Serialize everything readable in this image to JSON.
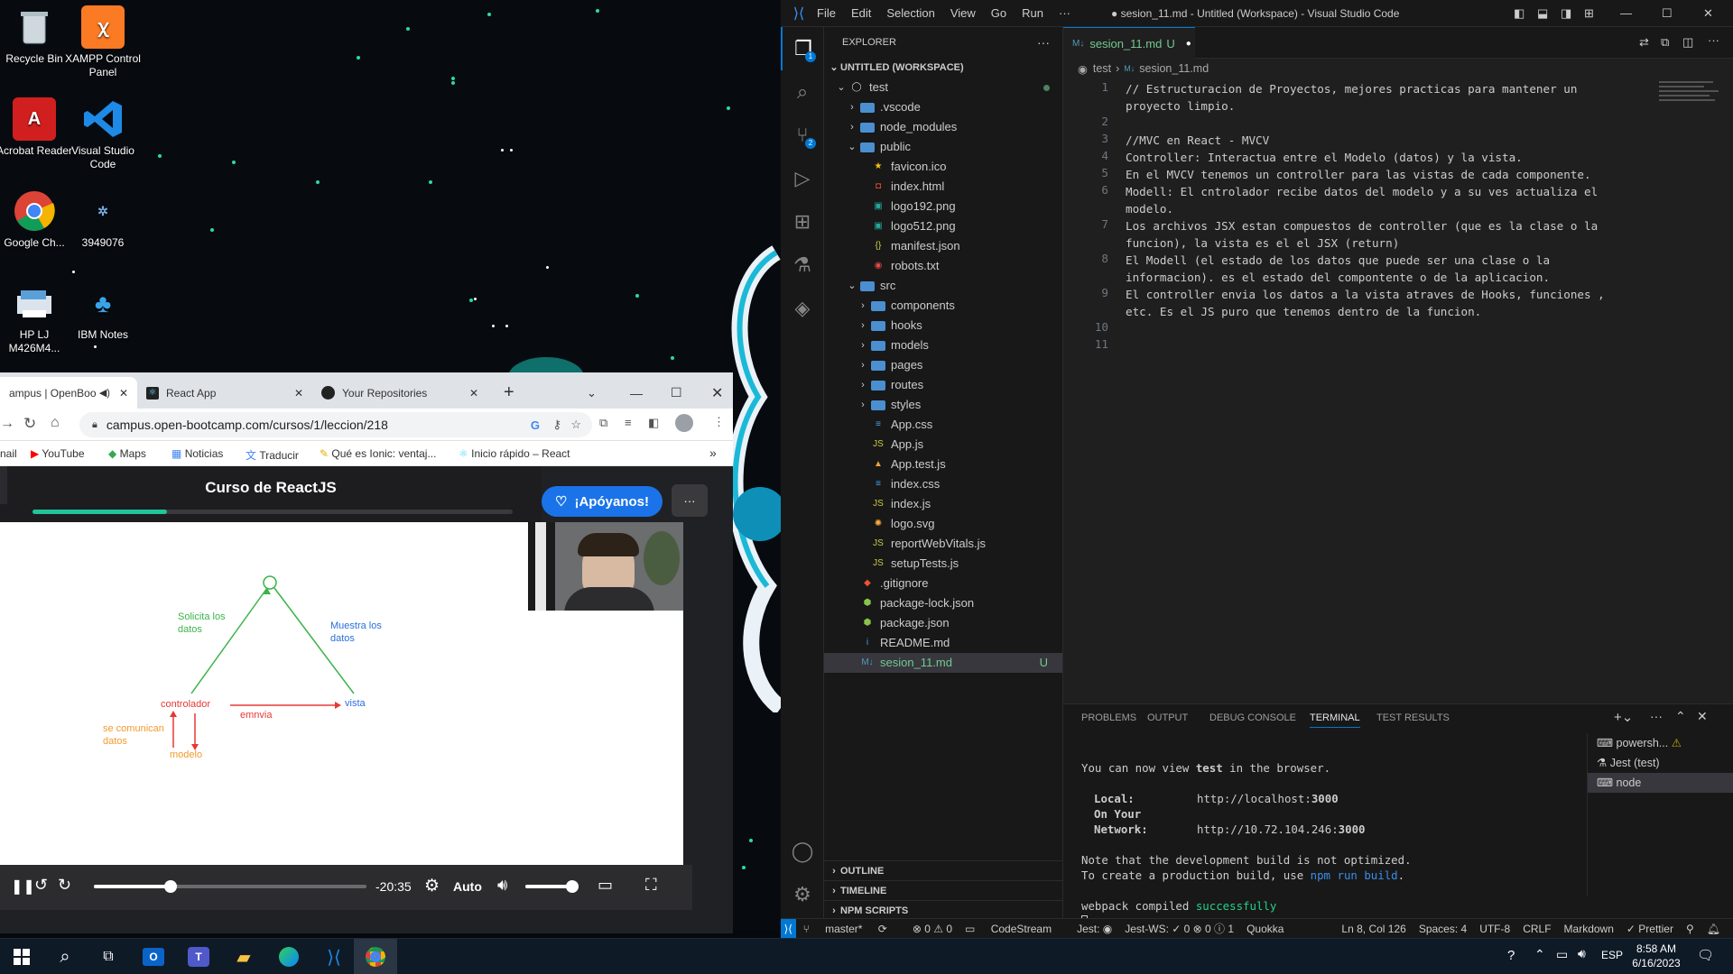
{
  "desktop": {
    "icons": [
      {
        "label": "Recycle Bin",
        "icon": "recycle-bin-icon"
      },
      {
        "label": "XAMPP Control Panel",
        "icon": "xampp-icon"
      },
      {
        "label": "Acrobat Reader",
        "icon": "acrobat-icon"
      },
      {
        "label": "Visual Studio Code",
        "icon": "vscode-icon"
      },
      {
        "label": "Google Ch...",
        "icon": "chrome-icon"
      },
      {
        "label": "3949076",
        "icon": "file-icon"
      },
      {
        "label": "HP LJ M426M4...",
        "icon": "printer-icon"
      },
      {
        "label": "IBM Notes",
        "icon": "ibm-notes-icon"
      }
    ]
  },
  "vscode": {
    "menu": [
      "File",
      "Edit",
      "Selection",
      "View",
      "Go",
      "Run",
      "···"
    ],
    "title": "● sesion_11.md - Untitled (Workspace) - Visual Studio Code",
    "explorer_title": "EXPLORER",
    "workspace": "UNTITLED (WORKSPACE)",
    "root": "test",
    "tree": [
      {
        "name": ".vscode",
        "depth": 1,
        "type": "folder",
        "open": false
      },
      {
        "name": "node_modules",
        "depth": 1,
        "type": "folder",
        "open": false
      },
      {
        "name": "public",
        "depth": 1,
        "type": "folder",
        "open": true
      },
      {
        "name": "favicon.ico",
        "depth": 2,
        "type": "file",
        "icon": "★",
        "color": "#f1c40f"
      },
      {
        "name": "index.html",
        "depth": 2,
        "type": "file",
        "icon": "◘",
        "color": "#e44d26"
      },
      {
        "name": "logo192.png",
        "depth": 2,
        "type": "file",
        "icon": "▣",
        "color": "#26a69a"
      },
      {
        "name": "logo512.png",
        "depth": 2,
        "type": "file",
        "icon": "▣",
        "color": "#26a69a"
      },
      {
        "name": "manifest.json",
        "depth": 2,
        "type": "file",
        "icon": "{}",
        "color": "#cbcb41"
      },
      {
        "name": "robots.txt",
        "depth": 2,
        "type": "file",
        "icon": "◉",
        "color": "#e24a4a"
      },
      {
        "name": "src",
        "depth": 1,
        "type": "folder",
        "open": true
      },
      {
        "name": "components",
        "depth": 2,
        "type": "folder",
        "open": false
      },
      {
        "name": "hooks",
        "depth": 2,
        "type": "folder",
        "open": false
      },
      {
        "name": "models",
        "depth": 2,
        "type": "folder",
        "open": false
      },
      {
        "name": "pages",
        "depth": 2,
        "type": "folder",
        "open": false
      },
      {
        "name": "routes",
        "depth": 2,
        "type": "folder",
        "open": false
      },
      {
        "name": "styles",
        "depth": 2,
        "type": "folder",
        "open": false
      },
      {
        "name": "App.css",
        "depth": 2,
        "type": "file",
        "icon": "≡",
        "color": "#42a5f5"
      },
      {
        "name": "App.js",
        "depth": 2,
        "type": "file",
        "icon": "JS",
        "color": "#cbcb41"
      },
      {
        "name": "App.test.js",
        "depth": 2,
        "type": "file",
        "icon": "▲",
        "color": "#e8a13a"
      },
      {
        "name": "index.css",
        "depth": 2,
        "type": "file",
        "icon": "≡",
        "color": "#42a5f5"
      },
      {
        "name": "index.js",
        "depth": 2,
        "type": "file",
        "icon": "JS",
        "color": "#cbcb41"
      },
      {
        "name": "logo.svg",
        "depth": 2,
        "type": "file",
        "icon": "✺",
        "color": "#ffb13b"
      },
      {
        "name": "reportWebVitals.js",
        "depth": 2,
        "type": "file",
        "icon": "JS",
        "color": "#cbcb41"
      },
      {
        "name": "setupTests.js",
        "depth": 2,
        "type": "file",
        "icon": "JS",
        "color": "#cbcb41"
      },
      {
        "name": ".gitignore",
        "depth": 1,
        "type": "file",
        "icon": "◆",
        "color": "#f05133"
      },
      {
        "name": "package-lock.json",
        "depth": 1,
        "type": "file",
        "icon": "⬢",
        "color": "#8bc34a"
      },
      {
        "name": "package.json",
        "depth": 1,
        "type": "file",
        "icon": "⬢",
        "color": "#8bc34a"
      },
      {
        "name": "README.md",
        "depth": 1,
        "type": "file",
        "icon": "i",
        "color": "#42a5f5"
      },
      {
        "name": "sesion_11.md",
        "depth": 1,
        "type": "file",
        "icon": "M↓",
        "color": "#519aba",
        "selected": true,
        "badge": "U"
      }
    ],
    "outline": "OUTLINE",
    "timeline": "TIMELINE",
    "npm_scripts": "NPM SCRIPTS",
    "tab": {
      "label": "sesion_11.md",
      "badge": "U"
    },
    "breadcrumb": [
      "test",
      "sesion_11.md"
    ],
    "lines": [
      {
        "n": "1",
        "text": "// Estructuracion de Proyectos, mejores practicas para mantener un"
      },
      {
        "n": "",
        "text": "proyecto limpio."
      },
      {
        "n": "2",
        "text": ""
      },
      {
        "n": "3",
        "text": "//MVC en React - MVCV"
      },
      {
        "n": "4",
        "text": "Controller: Interactua entre el Modelo (datos) y la vista."
      },
      {
        "n": "5",
        "text": "En el MVCV tenemos un controller para las vistas de cada componente."
      },
      {
        "n": "6",
        "text": "Modell: El cntrolador recibe datos del modelo y a su ves actualiza el"
      },
      {
        "n": "",
        "text": "modelo."
      },
      {
        "n": "7",
        "text": "Los archivos JSX estan compuestos de controller (que es la clase o la"
      },
      {
        "n": "",
        "text": "funcion), la vista es el el JSX (return)"
      },
      {
        "n": "8",
        "text": "El Modell (el estado de los datos que puede ser una clase o la"
      },
      {
        "n": "",
        "text": "informacion). es el estado del compontente o de la aplicacion."
      },
      {
        "n": "9",
        "text": "El controller envia los datos a la vista atraves de Hooks, funciones ,"
      },
      {
        "n": "",
        "text": "etc. Es el JS puro que tenemos dentro de la funcion."
      },
      {
        "n": "10",
        "text": ""
      },
      {
        "n": "11",
        "text": ""
      }
    ],
    "panel_tabs": [
      "PROBLEMS",
      "OUTPUT",
      "DEBUG CONSOLE",
      "TERMINAL",
      "TEST RESULTS"
    ],
    "terminal": {
      "l1_pre": "You can now view ",
      "l1_bold": "test",
      "l1_post": " in the browser.",
      "local_label": "Local:",
      "local_url_pre": "http://localhost:",
      "local_port": "3000",
      "net_label": "On Your Network:",
      "net_url_pre": "http://10.72.104.246:",
      "net_port": "3000",
      "note1": "Note that the development build is not optimized.",
      "note2_pre": "To create a production build, use ",
      "note2_cmd": "npm run build",
      "note2_post": ".",
      "compiled_pre": "webpack compiled ",
      "compiled_status": "successfully"
    },
    "terminals": [
      "powersh...",
      "Jest (test)",
      "node"
    ],
    "status": {
      "branch": "master*",
      "problems": "⊗ 0 ⚠ 0",
      "codestream": "CodeStream",
      "jest": "Jest: ◉",
      "jest_ws": "Jest-WS: ✓ 0 ⊗ 0 ⓘ 1",
      "quokka": "Quokka",
      "position": "Ln 8, Col 126",
      "spaces": "Spaces: 4",
      "encoding": "UTF-8",
      "eol": "CRLF",
      "language": "Markdown",
      "prettier": "✓ Prettier"
    }
  },
  "chrome": {
    "tabs": [
      {
        "label": "ampus | OpenBoot"
      },
      {
        "label": "React App"
      },
      {
        "label": "Your Repositories"
      }
    ],
    "url": "campus.open-bootcamp.com/cursos/1/leccion/218",
    "bookmarks": [
      "nail",
      "YouTube",
      "Maps",
      "Noticias",
      "Traducir",
      "Qué es Ionic: ventaj...",
      "Inicio rápido – React"
    ],
    "course_title": "Curso de ReactJS",
    "support_button": "¡Apóyanos!",
    "more_button": "···",
    "diagram": {
      "solicita": "Solicita los datos",
      "muestra": "Muestra los datos",
      "controlador": "controlador",
      "envia": "emnvia",
      "vista": "vista",
      "comunican": "se comunican datos",
      "modelo": "modelo"
    },
    "player": {
      "time": "-20:35",
      "quality": "Auto",
      "progress": 0.28,
      "volume": 0.9
    }
  },
  "taskbar": {
    "lang": "ESP",
    "time": "8:58 AM",
    "date": "6/16/2023"
  }
}
